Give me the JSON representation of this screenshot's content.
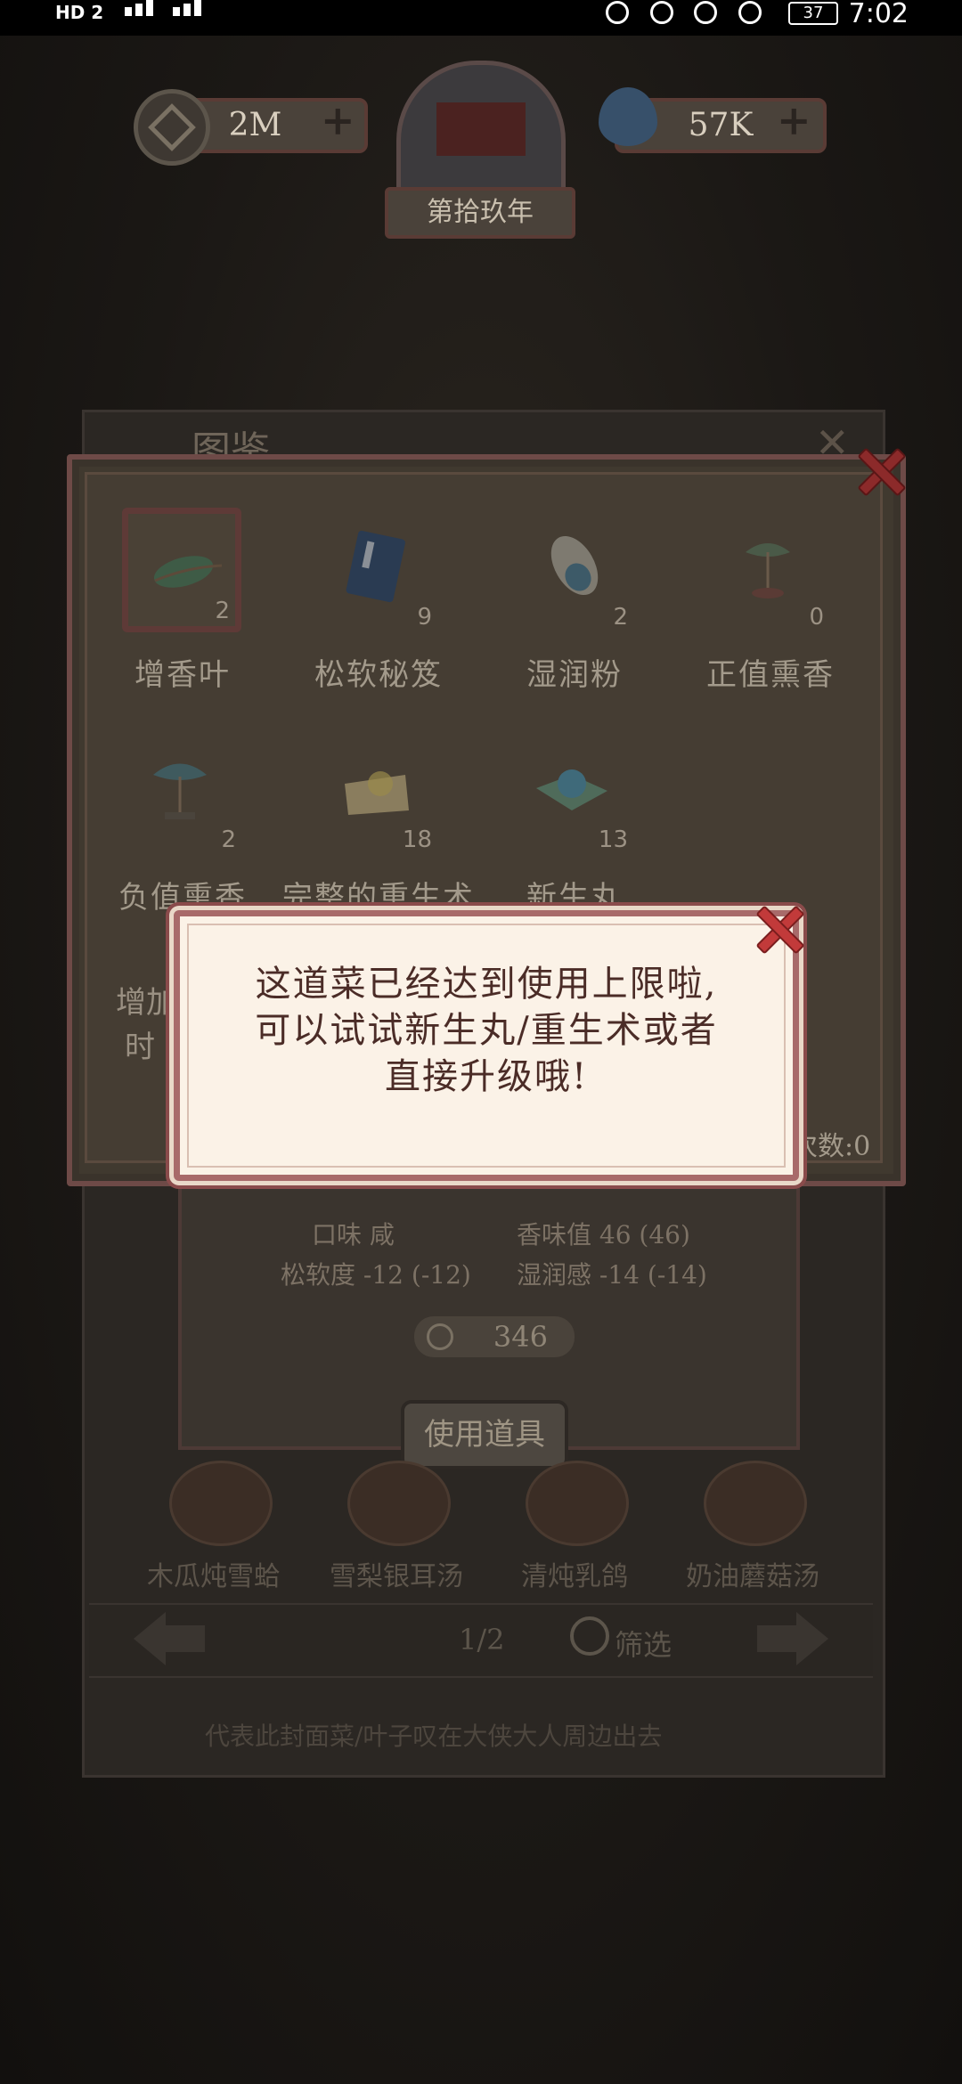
{
  "status_bar": {
    "network_label": "HD 2",
    "battery": "37",
    "time": "7:02"
  },
  "hud": {
    "coins": "2M",
    "water": "57K",
    "year": "第拾玖年"
  },
  "book": {
    "title": "图鉴",
    "stats": {
      "taste": "口味 咸",
      "aroma": "香味值 46 (46)",
      "softness": "松软度 -12 (-12)",
      "moisture": "湿润感 -14 (-14)"
    },
    "price": "346",
    "use_button": "使用道具",
    "dishes": [
      "木瓜炖雪蛤",
      "雪梨银耳汤",
      "清炖乳鸽",
      "奶油蘑菇汤"
    ],
    "page": "1/2",
    "filter": "筛选",
    "hint": "代表此封面菜/叶子叹在大侠大人周边出去"
  },
  "items_panel": {
    "items": [
      {
        "name": "增香叶",
        "count": "2",
        "icon": "leaf-icon"
      },
      {
        "name": "松软秘笈",
        "count": "9",
        "icon": "book-icon"
      },
      {
        "name": "湿润粉",
        "count": "2",
        "icon": "powder-pouch-icon"
      },
      {
        "name": "正值熏香",
        "count": "0",
        "icon": "incense-icon"
      },
      {
        "name": "负值熏香",
        "count": "2",
        "icon": "incense-icon"
      },
      {
        "name": "完整的重生术",
        "count": "18",
        "icon": "scroll-icon"
      },
      {
        "name": "新生丸",
        "count": "13",
        "icon": "pill-icon"
      }
    ],
    "partial_left_1": "增加",
    "partial_left_2": "时",
    "count_suffix": "次数:0"
  },
  "popup": {
    "line1": "这道菜已经达到使用上限啦,",
    "line2": "可以试试新生丸/重生术或者",
    "line3": "直接升级哦!"
  },
  "colors": {
    "overlay": "#141210",
    "popup_bg": "#fbf2e7",
    "popup_border": "#a86a6a",
    "close_red": "#c23a3a",
    "text_brown": "#4b2c27"
  }
}
